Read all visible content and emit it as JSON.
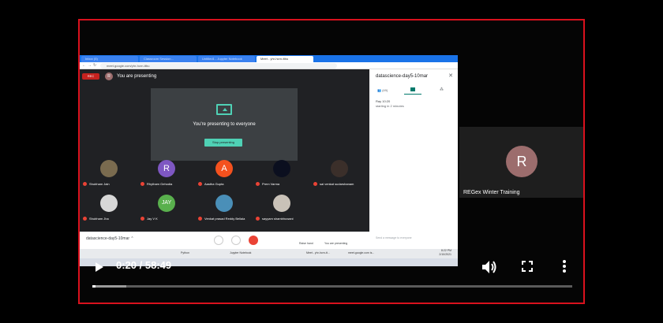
{
  "browser": {
    "tabs": [
      {
        "label": "Inbox (5)",
        "active": false
      },
      {
        "label": "Classroom Session...",
        "active": false
      },
      {
        "label": "Untitled1 - Jupyter Notebook",
        "active": false
      },
      {
        "label": "Meet - yhr-hcrn-ttbu",
        "active": true
      }
    ],
    "url": "meet.google.com/yhr-hcrn-ttbu"
  },
  "meet": {
    "rec_label": "REC",
    "presenter_initial": "R",
    "presenting_status": "You are presenting",
    "present_message": "You're presenting to everyone",
    "stop_button": "Stop presenting",
    "meeting_code": "datascience-day5-10mar",
    "raise_hand": "Raise hand",
    "you_presenting": "You are presenting"
  },
  "participants": [
    {
      "name": "Shubham Jain",
      "initial": "",
      "color": "#7a6b4f"
    },
    {
      "name": "Rhytham Gehodia",
      "initial": "R",
      "color": "#7e57c2"
    },
    {
      "name": "Aastha Gupta",
      "initial": "A",
      "color": "#f4511e"
    },
    {
      "name": "Prem Varma",
      "initial": "",
      "color": "#0b0f1f"
    },
    {
      "name": "sai venkat sudarshanam",
      "initial": "",
      "color": "#3b2f2a"
    },
    {
      "name": "Shubham Jha",
      "initial": "",
      "color": "#d7d7d7"
    },
    {
      "name": "Jay V K",
      "initial": "JAY",
      "color": "#59b04d"
    },
    {
      "name": "Venkat prasad Reddy Bellala",
      "initial": "",
      "color": "#4a8fb8"
    },
    {
      "name": "sayyam shambhuwani",
      "initial": "",
      "color": "#c9c2b8"
    }
  ],
  "side_panel": {
    "title": "datascience-day5-10mar",
    "people_count": "(49)",
    "msg_sender": "Ray  10:20",
    "msg_text": "starting in 2 minutes",
    "input_placeholder": "Send a message to everyone"
  },
  "taskbar": {
    "items": [
      "Python",
      "Jupyter Notebook",
      "Meet - yhr-hcrn-tt...",
      "meet.google.com is..."
    ],
    "clock": "8:22 PM",
    "date": "2/10/2021"
  },
  "right_tile": {
    "initial": "R",
    "name": "REGex Winter Training"
  },
  "player": {
    "timecode": "0:20 / 58:49",
    "played_fraction": 0.006,
    "buffered_fraction": 0.07
  },
  "colors": {
    "frame_border": "#d9111d",
    "meet_accent": "#4fd1b5",
    "chrome_blue": "#1a73e8"
  }
}
